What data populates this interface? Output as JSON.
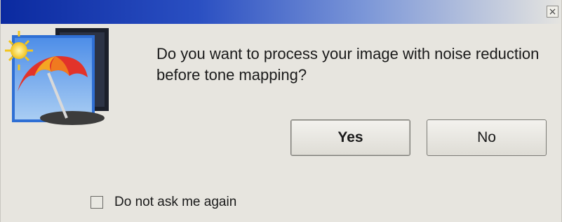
{
  "window": {
    "close_glyph": "×"
  },
  "dialog": {
    "message": "Do you want to process your image with noise reduction before tone mapping?",
    "yes_label": "Yes",
    "no_label": "No",
    "dont_ask_label": "Do not ask me again",
    "dont_ask_checked": false
  },
  "icons": {
    "app_icon": "beach-umbrella-sun-photo-icon",
    "close_icon": "close-icon"
  }
}
